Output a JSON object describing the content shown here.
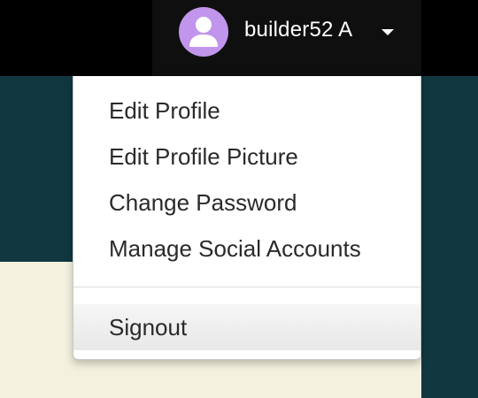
{
  "header": {
    "username": "builder52 A",
    "avatar_icon": "user-silhouette-icon",
    "caret_icon": "caret-down-icon",
    "avatar_color": "#c295ec"
  },
  "menu": {
    "items": [
      {
        "label": "Edit Profile"
      },
      {
        "label": "Edit Profile Picture"
      },
      {
        "label": "Change Password"
      },
      {
        "label": "Manage Social Accounts"
      }
    ],
    "signout_label": "Signout"
  },
  "colors": {
    "topbar": "#000000",
    "teal": "#113741",
    "cream": "#f4f2df",
    "menu_text": "#2a2a2a"
  }
}
